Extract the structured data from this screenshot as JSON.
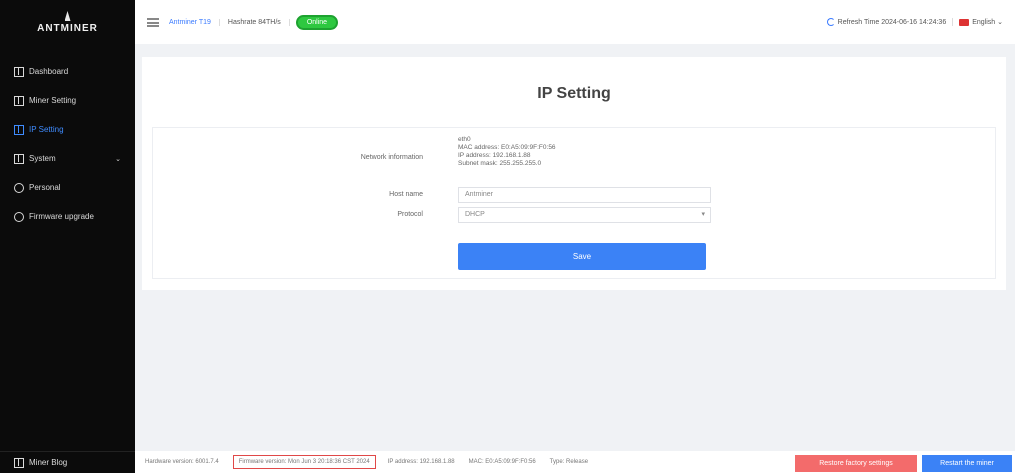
{
  "brand": {
    "logo_text": "ANTMINER"
  },
  "sidebar": {
    "items": [
      {
        "label": "Dashboard",
        "icon": "grid-icon"
      },
      {
        "label": "Miner Setting",
        "icon": "grid-icon"
      },
      {
        "label": "IP Setting",
        "icon": "grid-icon",
        "active": true
      },
      {
        "label": "System",
        "icon": "grid-icon",
        "has_submenu": true
      },
      {
        "label": "Personal",
        "icon": "gear-icon"
      },
      {
        "label": "Firmware upgrade",
        "icon": "clock-icon"
      }
    ],
    "bottom_label": "Miner Blog"
  },
  "header": {
    "model": "Antminer T19",
    "hashrate": "Hashrate 84TH/s",
    "status": "Online",
    "refresh_text": "Refresh Time 2024-06-16 14:24:36",
    "language": "English"
  },
  "page": {
    "title": "IP Setting",
    "network_info_label": "Network information",
    "network_info": {
      "line1": "eth0",
      "line2": "MAC address: E0:A5:09:9F:F0:56",
      "line3": "IP address: 192.168.1.88",
      "line4": "Subnet mask: 255.255.255.0"
    },
    "hostname_label": "Host name",
    "hostname_value": "Antminer",
    "protocol_label": "Protocol",
    "protocol_value": "DHCP",
    "save_label": "Save"
  },
  "footer": {
    "hardware_version": "Hardware version: 6001.7.4",
    "firmware_version": "Firmware version: Mon Jun 3 20:18:36 CST 2024",
    "ip_address": "IP address: 192.168.1.88",
    "mac": "MAC: E0:A5:09:9F:F0:56",
    "type": "Type: Release",
    "reset_label": "Restore factory settings",
    "restart_label": "Restart the miner"
  },
  "colors": {
    "accent": "#3b82f6",
    "danger": "#f36b6b",
    "online": "#2ec840",
    "sidebar_bg": "#0b0b0b"
  }
}
